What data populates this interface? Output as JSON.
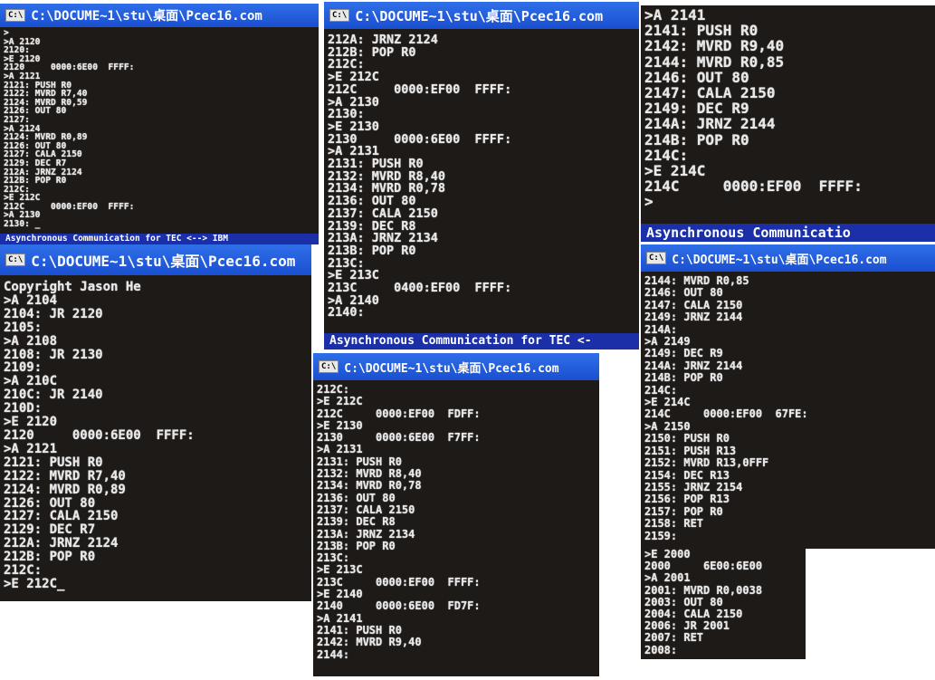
{
  "windows": [
    {
      "id": "w1",
      "title": "C:\\DOCUME~1\\stu\\桌面\\Pcec16.com",
      "lines": [
        ">",
        ">A 2120",
        "2120:",
        ">E 2120",
        "2120     0000:6E00  FFFF:",
        ">A 2121",
        "2121: PUSH R0",
        "2122: MVRD R7,40",
        "2124: MVRD R0,59",
        "2126: OUT 80",
        "2127:",
        ">A 2124",
        "2124: MVRD R0,89",
        "2126: OUT 80",
        "2127: CALA 2150",
        "2129: DEC R7",
        "212A: JRNZ 2124",
        "212B: POP R0",
        "212C:",
        ">E 212C",
        "212C     0000:EF00  FFFF:",
        ">A 2130",
        "2130: _"
      ],
      "status": "Asynchronous Communication for TEC <--> IBM"
    },
    {
      "id": "w2",
      "title": "C:\\DOCUME~1\\stu\\桌面\\Pcec16.com",
      "lines": [
        "212A: JRNZ 2124",
        "212B: POP R0",
        "212C:",
        ">E 212C",
        "212C     0000:EF00  FFFF:",
        ">A 2130",
        "2130:",
        ">E 2130",
        "2130     0000:6E00  FFFF:",
        ">A 2131",
        "2131: PUSH R0",
        "2132: MVRD R8,40",
        "2134: MVRD R0,78",
        "2136: OUT 80",
        "2137: CALA 2150",
        "2139: DEC R8",
        "213A: JRNZ 2134",
        "213B: POP R0",
        "213C:",
        ">E 213C",
        "213C     0400:EF00  FFFF:",
        ">A 2140",
        "2140:"
      ],
      "status": "Asynchronous Communication for TEC <-"
    },
    {
      "id": "w3",
      "title": "",
      "lines": [
        ">A 2141",
        "2141: PUSH R0",
        "2142: MVRD R9,40",
        "2144: MVRD R0,85",
        "2146: OUT 80",
        "2147: CALA 2150",
        "2149: DEC R9",
        "214A: JRNZ 2144",
        "214B: POP R0",
        "214C:",
        ">E 214C",
        "214C     0000:EF00  FFFF:",
        ">"
      ],
      "status": "Asynchronous Communicatio"
    },
    {
      "id": "w4",
      "title": "C:\\DOCUME~1\\stu\\桌面\\Pcec16.com",
      "lines": [
        "Copyright Jason He",
        ">A 2104",
        "2104: JR 2120",
        "2105:",
        ">A 2108",
        "2108: JR 2130",
        "2109:",
        ">A 210C",
        "210C: JR 2140",
        "210D:",
        ">E 2120",
        "2120     0000:6E00  FFFF:",
        ">A 2121",
        "2121: PUSH R0",
        "2122: MVRD R7,40",
        "2124: MVRD R0,89",
        "2126: OUT 80",
        "2127: CALA 2150",
        "2129: DEC R7",
        "212A: JRNZ 2124",
        "212B: POP R0",
        "212C:",
        ">E 212C_"
      ],
      "status": ""
    },
    {
      "id": "w5",
      "title": "C:\\DOCUME~1\\stu\\桌面\\Pcec16.com",
      "lines": [
        "212C:",
        ">E 212C",
        "212C     0000:EF00  FDFF:",
        ">E 2130",
        "2130     0000:6E00  F7FF:",
        ">A 2131",
        "2131: PUSH R0",
        "2132: MVRD R8,40",
        "2134: MVRD R0,78",
        "2136: OUT 80",
        "2137: CALA 2150",
        "2139: DEC R8",
        "213A: JRNZ 2134",
        "213B: POP R0",
        "213C:",
        ">E 213C",
        "213C     0000:EF00  FFFF:",
        ">E 2140",
        "2140     0000:6E00  FD7F:",
        ">A 2141",
        "2141: PUSH R0",
        "2142: MVRD R9,40",
        "2144:"
      ],
      "status": ""
    },
    {
      "id": "w6",
      "title": "C:\\DOCUME~1\\stu\\桌面\\Pcec16.com",
      "lines": [
        "2144: MVRD R0,85",
        "2146: OUT 80",
        "2147: CALA 2150",
        "2149: JRNZ 2144",
        "214A:",
        ">A 2149",
        "2149: DEC R9",
        "214A: JRNZ 2144",
        "214B: POP R0",
        "214C:",
        ">E 214C",
        "214C     0000:EF00  67FE:",
        ">A 2150",
        "2150: PUSH R0",
        "2151: PUSH R13",
        "2152: MVRD R13,0FFF",
        "2154: DEC R13",
        "2155: JRNZ 2154",
        "2156: POP R13",
        "2157: POP R0",
        "2158: RET",
        "2159:"
      ],
      "status": ""
    },
    {
      "id": "w7",
      "title": "",
      "lines": [
        ">E 2000",
        "2000     6E00:6E00",
        ">A 2001",
        "2001: MVRD R0,0038",
        "2003: OUT 80",
        "2004: CALA 2150",
        "2006: JR 2001",
        "2007: RET",
        "2008:"
      ],
      "status": ""
    }
  ]
}
